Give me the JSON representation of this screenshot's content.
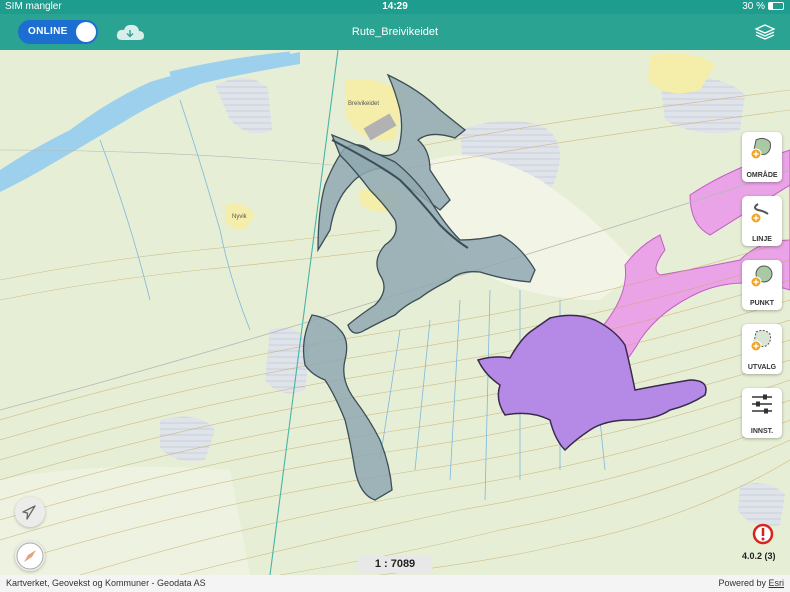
{
  "status_bar": {
    "carrier": "SIM mangler",
    "time": "14:29",
    "battery": "30 %"
  },
  "nav_bar": {
    "toggle_label": "ONLINE",
    "title": "Rute_Breivikeidet"
  },
  "map": {
    "place_labels": [
      "Breivikeidet",
      "Nyvik"
    ],
    "scale": "1 : 7089",
    "version": "4.0.2 (3)",
    "attribution": "Kartverket, Geovekst og Kommuner - Geodata AS",
    "powered_by": "Powered by",
    "powered_by_link": "Esri"
  },
  "tools": [
    {
      "id": "omrade",
      "label": "OMRÅDE",
      "icon": "polygon-add-icon"
    },
    {
      "id": "linje",
      "label": "LINJE",
      "icon": "line-add-icon"
    },
    {
      "id": "punkt",
      "label": "PUNKT",
      "icon": "point-add-icon"
    },
    {
      "id": "utvalg",
      "label": "UTVALG",
      "icon": "selection-add-icon"
    },
    {
      "id": "innst",
      "label": "INNST.",
      "icon": "settings-sliders-icon"
    }
  ],
  "colors": {
    "header": "#2aa392",
    "toggle": "#1c6fd1",
    "gray_polygon": "#8fa8b2",
    "purple_polygon": "#b58ae6",
    "pink_area": "#e9a3e6",
    "water": "#9dd0ec",
    "accent_orange": "#f0a526"
  }
}
